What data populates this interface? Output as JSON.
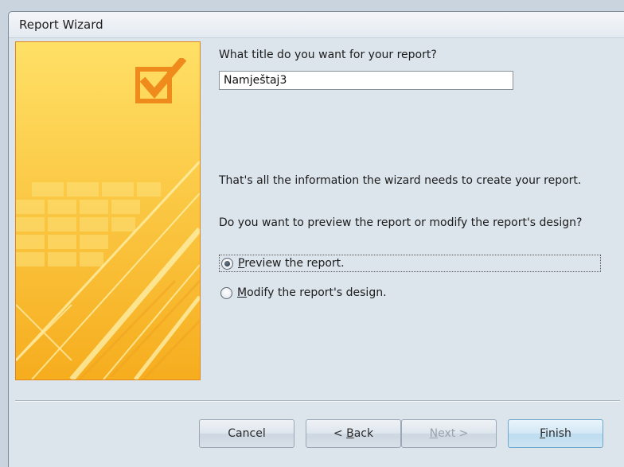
{
  "window": {
    "title": "Report Wizard"
  },
  "form": {
    "title_question": "What title do you want for your report?",
    "title_value": "Namještaj3",
    "info_text": "That's all the information the wizard needs to create your report.",
    "preview_question": "Do you want to preview the report or modify the report's design?",
    "options": [
      {
        "label_prefix": "",
        "access_key": "P",
        "label_rest": "review the report.",
        "selected": true
      },
      {
        "label_prefix": "",
        "access_key": "M",
        "label_rest": "odify the report's design.",
        "selected": false
      }
    ]
  },
  "buttons": {
    "cancel": "Cancel",
    "back_prefix": "< ",
    "back_key": "B",
    "back_rest": "ack",
    "next_key": "N",
    "next_rest": "ext >",
    "finish_key": "F",
    "finish_rest": "inish"
  },
  "colors": {
    "panel_yellow": "#fcc62b",
    "panel_border": "#e2851e",
    "window_bg": "#dce4ec"
  },
  "icons": {
    "panel_icon": "checkbox-checkmark-icon"
  }
}
